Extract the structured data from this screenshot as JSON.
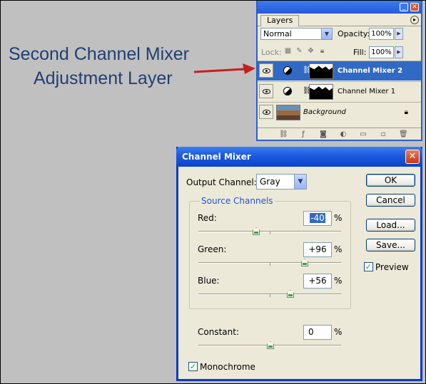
{
  "caption": {
    "line1": "Second Channel Mixer",
    "line2": "Adjustment Layer"
  },
  "layers_panel": {
    "tab_label": "Layers",
    "blend_mode": "Normal",
    "opacity_label": "Opacity:",
    "opacity_value": "100%",
    "lock_label": "Lock:",
    "fill_label": "Fill:",
    "fill_value": "100%",
    "layers": [
      {
        "name": "Channel Mixer 2",
        "selected": true
      },
      {
        "name": "Channel Mixer 1",
        "selected": false
      },
      {
        "name": "Background",
        "selected": false
      }
    ]
  },
  "channel_mixer": {
    "title": "Channel Mixer",
    "output_channel_label": "Output Channel:",
    "output_channel_value": "Gray",
    "source_channels_label": "Source Channels",
    "red_label": "Red:",
    "red_value": "-40",
    "green_label": "Green:",
    "green_value": "+96",
    "blue_label": "Blue:",
    "blue_value": "+56",
    "constant_label": "Constant:",
    "constant_value": "0",
    "percent": "%",
    "ok_label": "OK",
    "cancel_label": "Cancel",
    "load_label": "Load...",
    "save_label": "Save...",
    "preview_label": "Preview",
    "preview_checked": true,
    "monochrome_label": "Monochrome",
    "monochrome_checked": true
  },
  "colors": {
    "caption": "#1f3f73",
    "arrow": "#c81e1e",
    "selection": "#316ac5"
  }
}
